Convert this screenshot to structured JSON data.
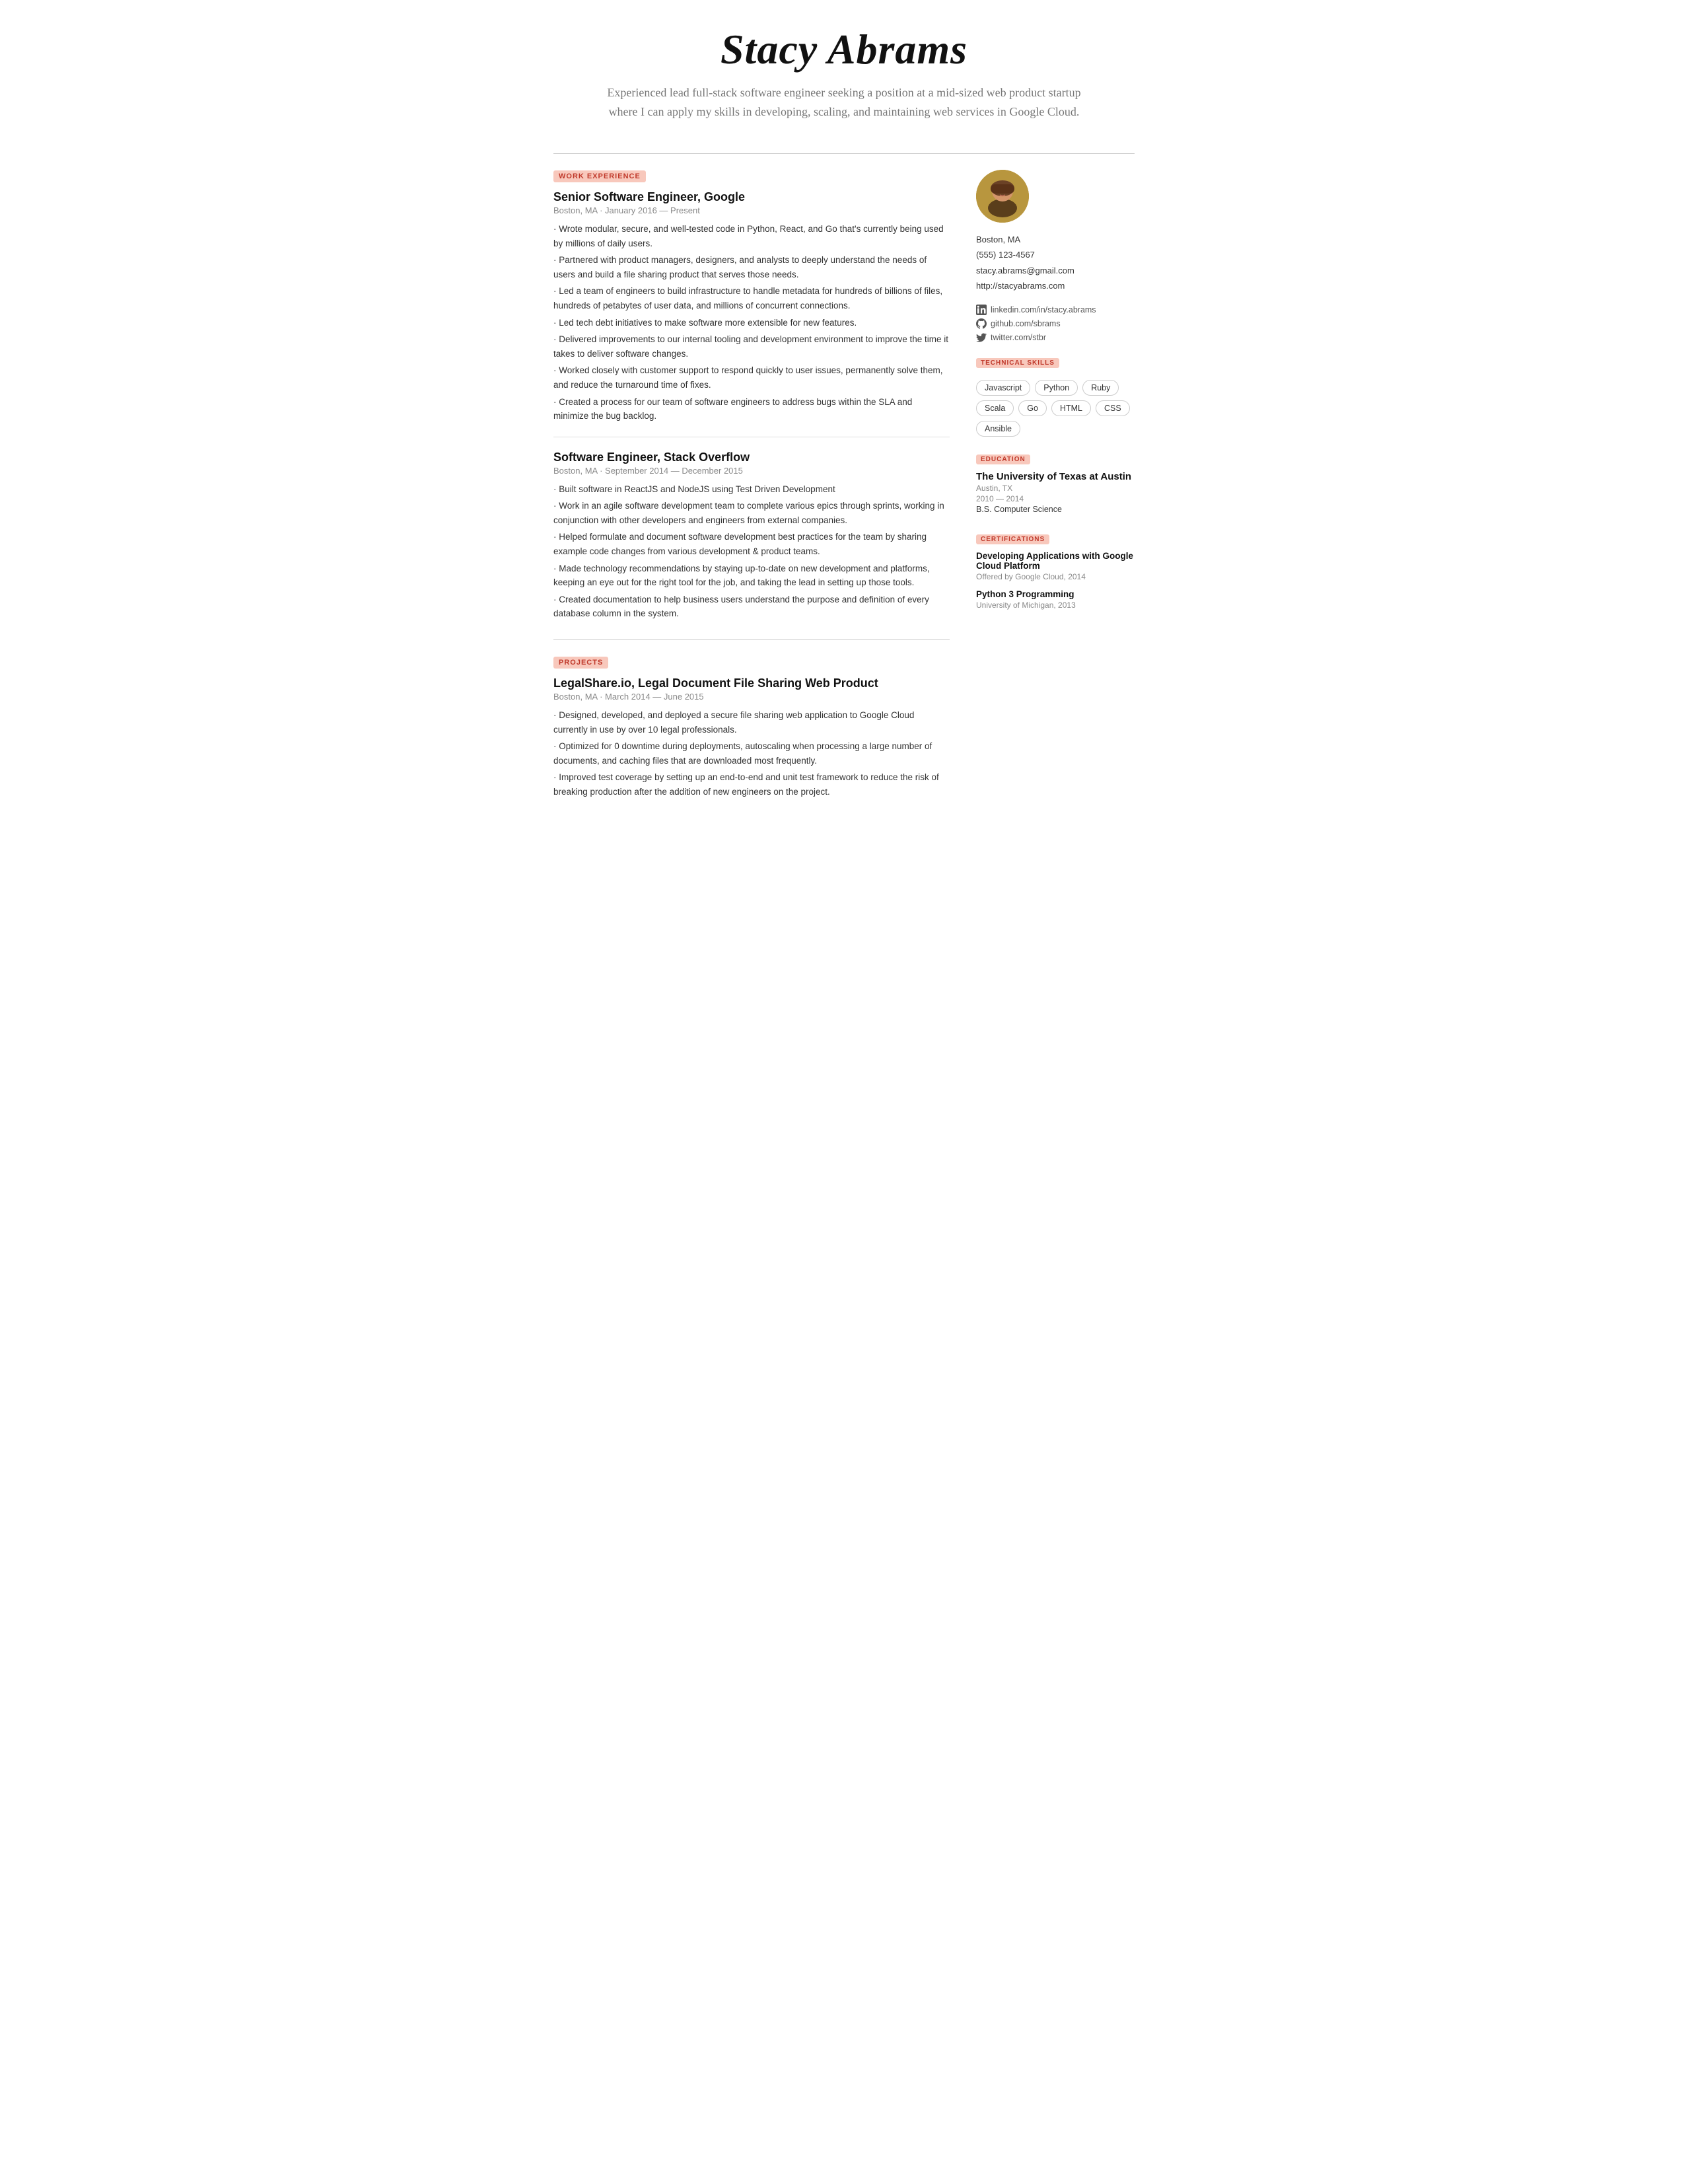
{
  "header": {
    "name": "Stacy Abrams",
    "summary": "Experienced lead full-stack software engineer seeking a position at a mid-sized web product startup where I can apply my skills in developing, scaling, and maintaining web services in Google Cloud."
  },
  "contact": {
    "location": "Boston, MA",
    "phone": "(555) 123-4567",
    "email": "stacy.abrams@gmail.com",
    "website": "http://stacyabrams.com"
  },
  "social": [
    {
      "icon": "in",
      "text": "linkedin.com/in/stacy.abrams"
    },
    {
      "icon": "gh",
      "text": "github.com/sbrams"
    },
    {
      "icon": "tw",
      "text": "twitter.com/stbr"
    }
  ],
  "sections": {
    "work_experience_label": "WORK EXPERIENCE",
    "projects_label": "PROJECTS",
    "technical_skills_label": "TECHNICAL SKILLS",
    "education_label": "EDUCATION",
    "certifications_label": "CERTIFICATIONS"
  },
  "jobs": [
    {
      "title": "Senior Software Engineer, Google",
      "meta": "Boston, MA · January 2016 — Present",
      "bullets": [
        "· Wrote modular, secure, and well-tested code in Python, React, and Go that's currently being used by millions of daily users.",
        "· Partnered with product managers, designers, and analysts to deeply understand the needs of users and build a file sharing product that serves those needs.",
        "· Led a team of engineers to build infrastructure to handle metadata for hundreds of billions of files, hundreds of petabytes of user data, and millions of concurrent connections.",
        "· Led tech debt initiatives to make software more extensible for new features.",
        "· Delivered improvements to our internal tooling and development environment to improve the time it takes to deliver software changes.",
        "· Worked closely with customer support to respond quickly to user issues, permanently solve them, and reduce the turnaround time of fixes.",
        "· Created a process for our team of software engineers to address bugs within the SLA and minimize the bug backlog."
      ]
    },
    {
      "title": "Software Engineer, Stack Overflow",
      "meta": "Boston, MA · September 2014 — December 2015",
      "bullets": [
        "· Built software in ReactJS and NodeJS using Test Driven Development",
        "· Work in an agile software development team to complete various epics through sprints, working in conjunction with other developers and engineers from external companies.",
        "· Helped formulate and document software development best practices for the team by sharing example code changes from various development & product teams.",
        "· Made technology recommendations by staying up-to-date on new development and platforms, keeping an eye out for the right tool for the job, and taking the lead in setting up those tools.",
        "· Created documentation to help business users understand the purpose and definition of every database column in the system."
      ]
    }
  ],
  "projects": [
    {
      "title": "LegalShare.io, Legal Document File Sharing Web Product",
      "meta": "Boston, MA · March 2014 — June 2015",
      "bullets": [
        "· Designed, developed, and deployed a secure file sharing web application to Google Cloud currently in use by over 10 legal professionals.",
        "· Optimized for 0 downtime during deployments, autoscaling when processing a large number of documents, and caching files that are downloaded most frequently.",
        "· Improved test coverage by setting up an end-to-end and unit test framework to reduce the risk of breaking production after the addition of new engineers on the project."
      ]
    }
  ],
  "skills": [
    "Javascript",
    "Python",
    "Ruby",
    "Scala",
    "Go",
    "HTML",
    "CSS",
    "Ansible"
  ],
  "education": [
    {
      "school": "The University of Texas at Austin",
      "location": "Austin, TX",
      "years": "2010 — 2014",
      "degree": "B.S. Computer Science"
    }
  ],
  "certifications": [
    {
      "title": "Developing Applications with Google Cloud Platform",
      "meta": "Offered by Google Cloud, 2014"
    },
    {
      "title": "Python 3 Programming",
      "meta": "University of Michigan, 2013"
    }
  ]
}
